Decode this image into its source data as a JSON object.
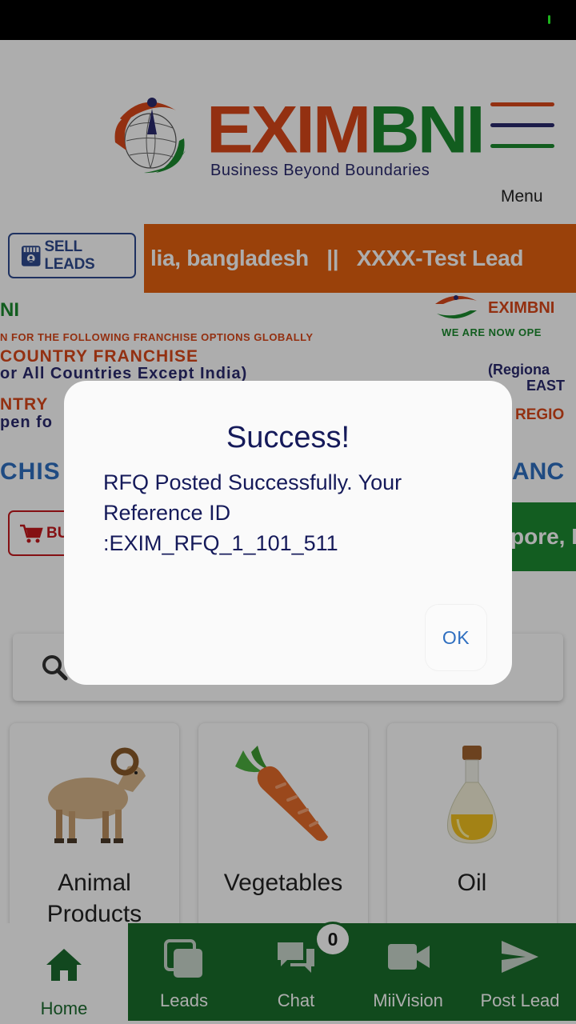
{
  "header": {
    "logo_part1": "EXIM",
    "logo_part2": "BNI",
    "tagline": "Business Beyond Boundaries",
    "menu_label": "Menu",
    "menu_icon": "hamburger-icon"
  },
  "ticker": {
    "sell_leads_label": "SELL LEADS",
    "scroll_text": "lia, bangladesh   ||   XXXX-Test Lead",
    "store_icon": "store-icon"
  },
  "banner": {
    "brand_left": "NI",
    "line_invite": "N FOR THE FOLLOWING FRANCHISE OPTIONS GLOBALLY",
    "line_country_franchise": "COUNTRY FRANCHISE",
    "line_all_countries": "or All Countries Except India)",
    "line_ntry": "NTRY",
    "line_open": "pen fo",
    "line_chis": "CHIS",
    "brand_right": "EXIMBNI",
    "right_now_open": "WE ARE NOW OPE",
    "right_region": "(Regiona",
    "right_east": "EAST",
    "right_regio": "REGIO",
    "right_anc": "ANC",
    "buy_leads_label": "BU",
    "cart_icon": "cart-icon",
    "green_scroll": "pore, I"
  },
  "search": {
    "icon": "search-icon"
  },
  "categories": [
    {
      "name": "Animal Products",
      "icon": "ram-icon"
    },
    {
      "name": "Vegetables",
      "icon": "carrot-icon"
    },
    {
      "name": "Oil",
      "icon": "oil-bottle-icon"
    }
  ],
  "bottom_nav": {
    "home": "Home",
    "leads": "Leads",
    "chat": "Chat",
    "chat_badge": "0",
    "miivision": "MiiVision",
    "post_lead": "Post Lead"
  },
  "dialog": {
    "title": "Success!",
    "message": "RFQ Posted Successfully. Your Reference ID :EXIM_RFQ_1_101_511",
    "ok": "OK"
  },
  "colors": {
    "brand_orange": "#e4600f",
    "brand_green": "#1a6e2c",
    "dialog_text": "#151a5a",
    "ok_blue": "#2f6fc0"
  }
}
